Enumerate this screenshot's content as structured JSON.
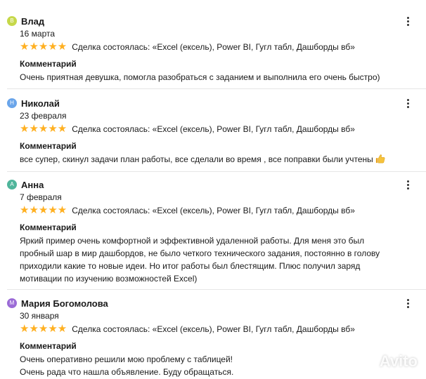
{
  "colors": {
    "star": "#ffb021",
    "avatar_v": "#c6d84a",
    "avatar_n": "#6aa5ea",
    "avatar_a": "#4fb59b",
    "avatar_m": "#9b6bd6"
  },
  "reviews": [
    {
      "initial": "В",
      "author": "Влад",
      "date": "16 марта",
      "rating": 5,
      "stars": "★★★★★",
      "deal": "Сделка состоялась: «Excel (ексель), Power BI, Гугл табл, Дашборды вб»",
      "comment_title": "Комментарий",
      "comment_lines": [
        "Очень приятная девушка, помогла разобраться с заданием и выполнила его очень быстро)"
      ]
    },
    {
      "initial": "Н",
      "author": "Николай",
      "date": "23 февраля",
      "rating": 5,
      "stars": "★★★★★",
      "deal": "Сделка состоялась: «Excel (ексель), Power BI, Гугл табл, Дашборды вб»",
      "comment_title": "Комментарий",
      "comment_lines": [
        "все супер, скинул задачи план работы, все сделали во время , все поправки были учтены"
      ],
      "comment_icon": "thumbs-up-icon"
    },
    {
      "initial": "А",
      "author": "Анна",
      "date": "7 февраля",
      "rating": 5,
      "stars": "★★★★★",
      "deal": "Сделка состоялась: «Excel (ексель), Power BI, Гугл табл, Дашборды вб»",
      "comment_title": "Комментарий",
      "comment_lines": [
        "Яркий пример очень комфортной и эффективной удаленной работы. Для меня это был",
        "пробный шар в мир дашбордов, не было четкого технического задания, постоянно в голову",
        "приходили какие то новые идеи. Но итог работы был блестящим. Плюс получил заряд",
        "мотивации по изучению возможностей Excel)"
      ]
    },
    {
      "initial": "М",
      "author": "Мария Богомолова",
      "date": "30 января",
      "rating": 5,
      "stars": "★★★★★",
      "deal": "Сделка состоялась: «Excel (ексель), Power BI, Гугл табл, Дашборды вб»",
      "comment_title": "Комментарий",
      "comment_lines": [
        "Очень оперативно решили мою проблему с таблицей!",
        "Очень рада что нашла объявление. Буду обращаться."
      ]
    }
  ],
  "watermark": {
    "text": "Avito",
    "icon": "avito-logo-icon"
  }
}
